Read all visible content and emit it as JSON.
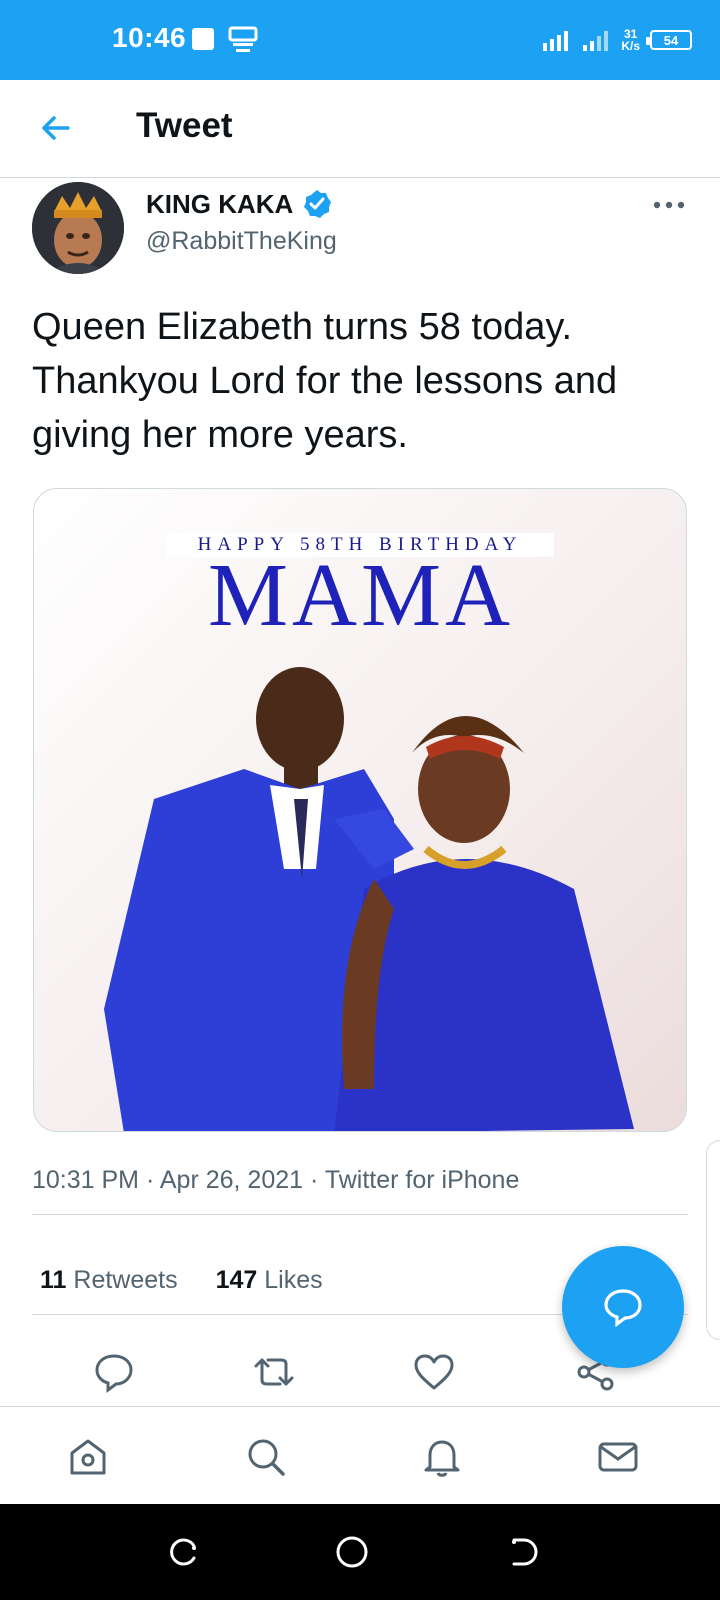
{
  "status_bar": {
    "time": "10:46",
    "net_speed_value": "31",
    "net_speed_unit": "K/s",
    "battery": "54"
  },
  "header": {
    "title": "Tweet"
  },
  "tweet": {
    "author_name": "KING KAKA",
    "author_handle": "@RabbitTheKing",
    "text": "Queen Elizabeth turns 58 today. Thankyou Lord for the lessons and giving her more years.",
    "media": {
      "banner_small": "HAPPY 58TH BIRTHDAY",
      "banner_big": "MAMA"
    },
    "time": "10:31 PM",
    "date": "Apr 26, 2021",
    "client": "Twitter for iPhone",
    "retweets_count": "11",
    "retweets_label": "Retweets",
    "likes_count": "147",
    "likes_label": "Likes"
  },
  "colors": {
    "accent": "#1da1f2",
    "text": "#0f1419",
    "secondary": "#536471",
    "border": "#cfd9de"
  },
  "icons": [
    "back-arrow-icon",
    "verified-badge-icon",
    "more-icon",
    "reply-icon",
    "retweet-icon",
    "like-icon",
    "share-icon",
    "compose-reply-icon",
    "home-icon",
    "search-icon",
    "notifications-icon",
    "messages-icon"
  ]
}
